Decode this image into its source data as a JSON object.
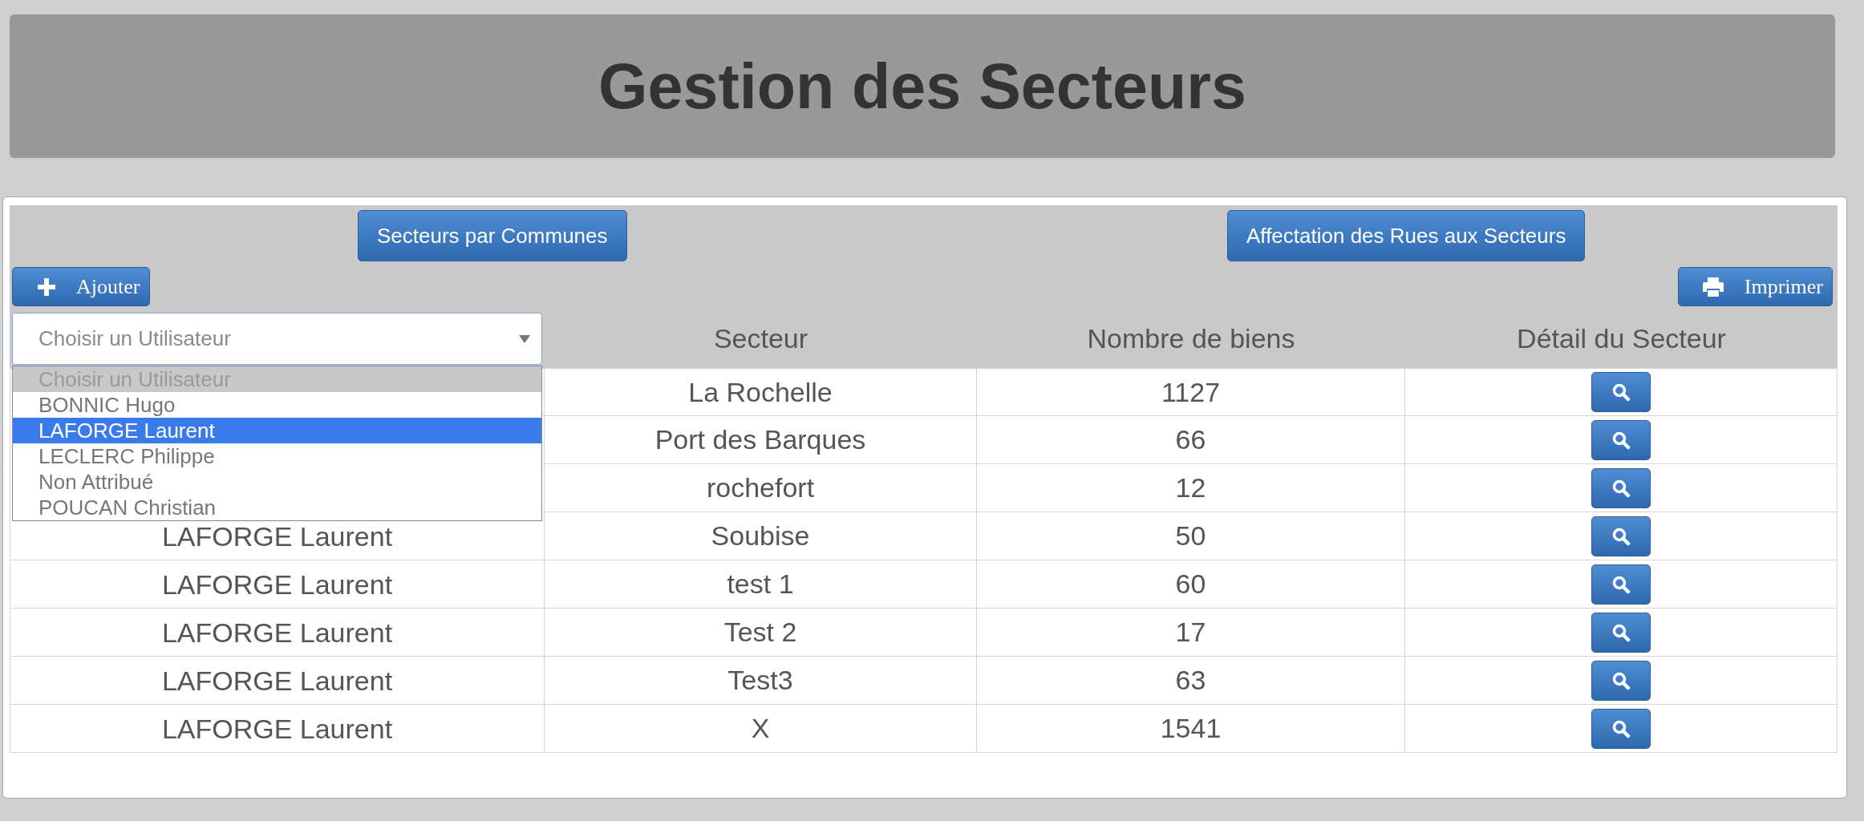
{
  "header": {
    "title": "Gestion des Secteurs"
  },
  "toolbar": {
    "nav_buttons": [
      {
        "label": "Secteurs par Communes"
      },
      {
        "label": "Affectation des Rues aux Secteurs"
      }
    ],
    "add_button": {
      "label": "Ajouter"
    },
    "print_button": {
      "label": "Imprimer"
    }
  },
  "table": {
    "user_filter": {
      "placeholder": "Choisir un Utilisateur",
      "expanded": true,
      "options": [
        {
          "label": "Choisir un Utilisateur",
          "disabled": true,
          "selected": false
        },
        {
          "label": "BONNIC Hugo",
          "disabled": false,
          "selected": false
        },
        {
          "label": "LAFORGE Laurent",
          "disabled": false,
          "selected": true
        },
        {
          "label": "LECLERC Philippe",
          "disabled": false,
          "selected": false
        },
        {
          "label": "Non Attribué",
          "disabled": false,
          "selected": false
        },
        {
          "label": "POUCAN Christian",
          "disabled": false,
          "selected": false
        }
      ]
    },
    "columns": [
      "Secteur",
      "Nombre de biens",
      "Détail du Secteur"
    ],
    "rows": [
      {
        "sector": "La Rochelle",
        "count": "1127"
      },
      {
        "sector": "Port des Barques",
        "count": "66"
      },
      {
        "sector": "rochefort",
        "count": "12"
      },
      {
        "user": "LAFORGE Laurent",
        "sector": "Soubise",
        "count": "50"
      },
      {
        "user": "LAFORGE Laurent",
        "sector": "test 1",
        "count": "60"
      },
      {
        "user": "LAFORGE Laurent",
        "sector": "Test 2",
        "count": "17"
      },
      {
        "user": "LAFORGE Laurent",
        "sector": "Test3",
        "count": "63"
      },
      {
        "user": "LAFORGE Laurent",
        "sector": "X",
        "count": "1541"
      }
    ]
  }
}
